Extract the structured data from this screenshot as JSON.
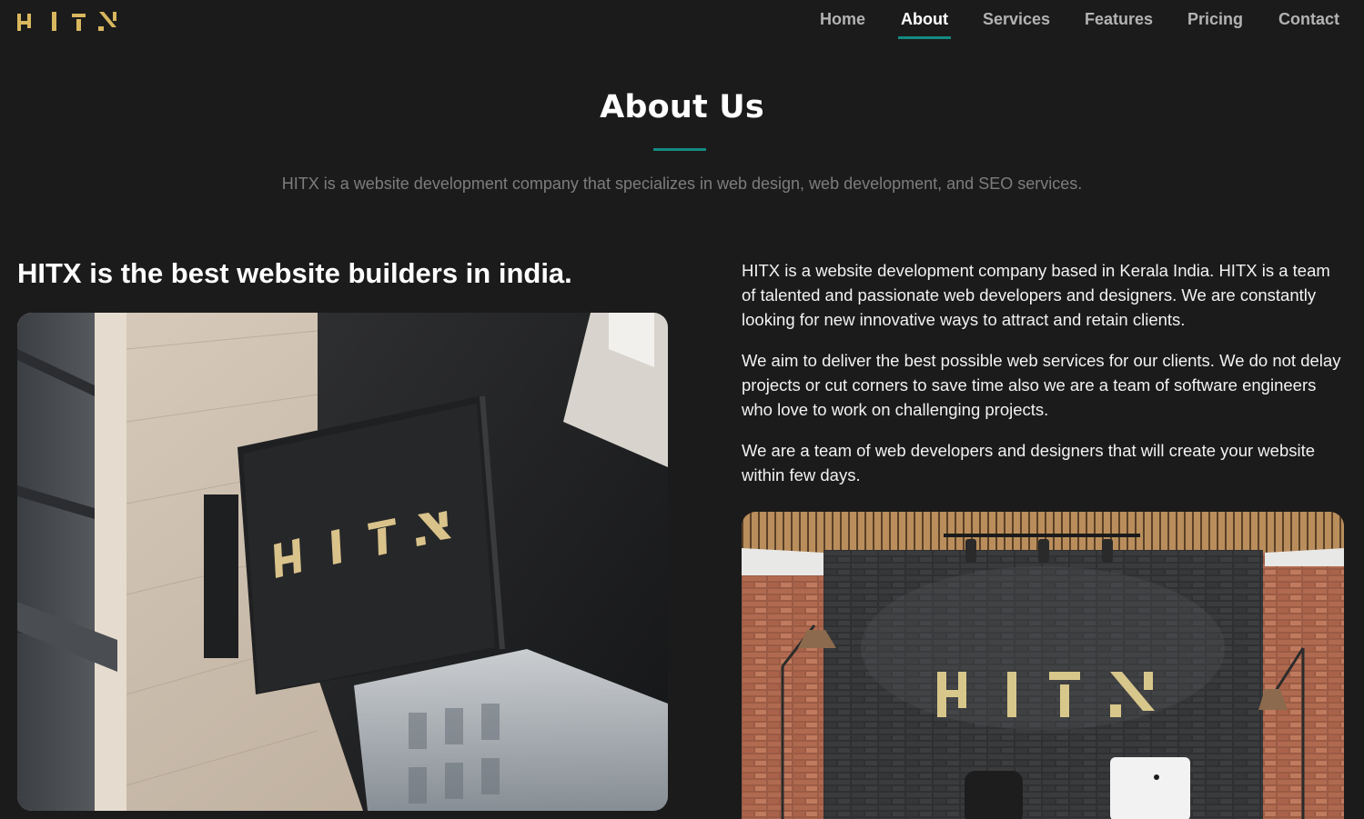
{
  "brand": {
    "logo_text": "HITX",
    "logo_color": "#d8b75e"
  },
  "nav": {
    "items": [
      {
        "label": "Home"
      },
      {
        "label": "About"
      },
      {
        "label": "Services"
      },
      {
        "label": "Features"
      },
      {
        "label": "Pricing"
      },
      {
        "label": "Contact"
      }
    ],
    "active": "About",
    "accent": "#148a82"
  },
  "hero": {
    "title": "About Us",
    "intro": "HITX is a website development company that specializes in web design, web development, and SEO services."
  },
  "left": {
    "heading": "HITX is the best website builders in india."
  },
  "right": {
    "paragraphs": [
      "HITX is a website development company based in Kerala India. HITX is a team of talented and passionate web developers and designers. We are constantly looking for new innovative ways to attract and retain clients.",
      "We aim to deliver the best possible web services for our clients. We do not delay projects or cut corners to save time also we are a team of software engineers who love to work on challenging projects.",
      "We are a team of web developers and designers that will create your website within few days."
    ]
  },
  "colors": {
    "background": "#1b1b1b",
    "accent": "#148a82",
    "muted": "#7d7d7d",
    "gold": "#d8b75e"
  }
}
